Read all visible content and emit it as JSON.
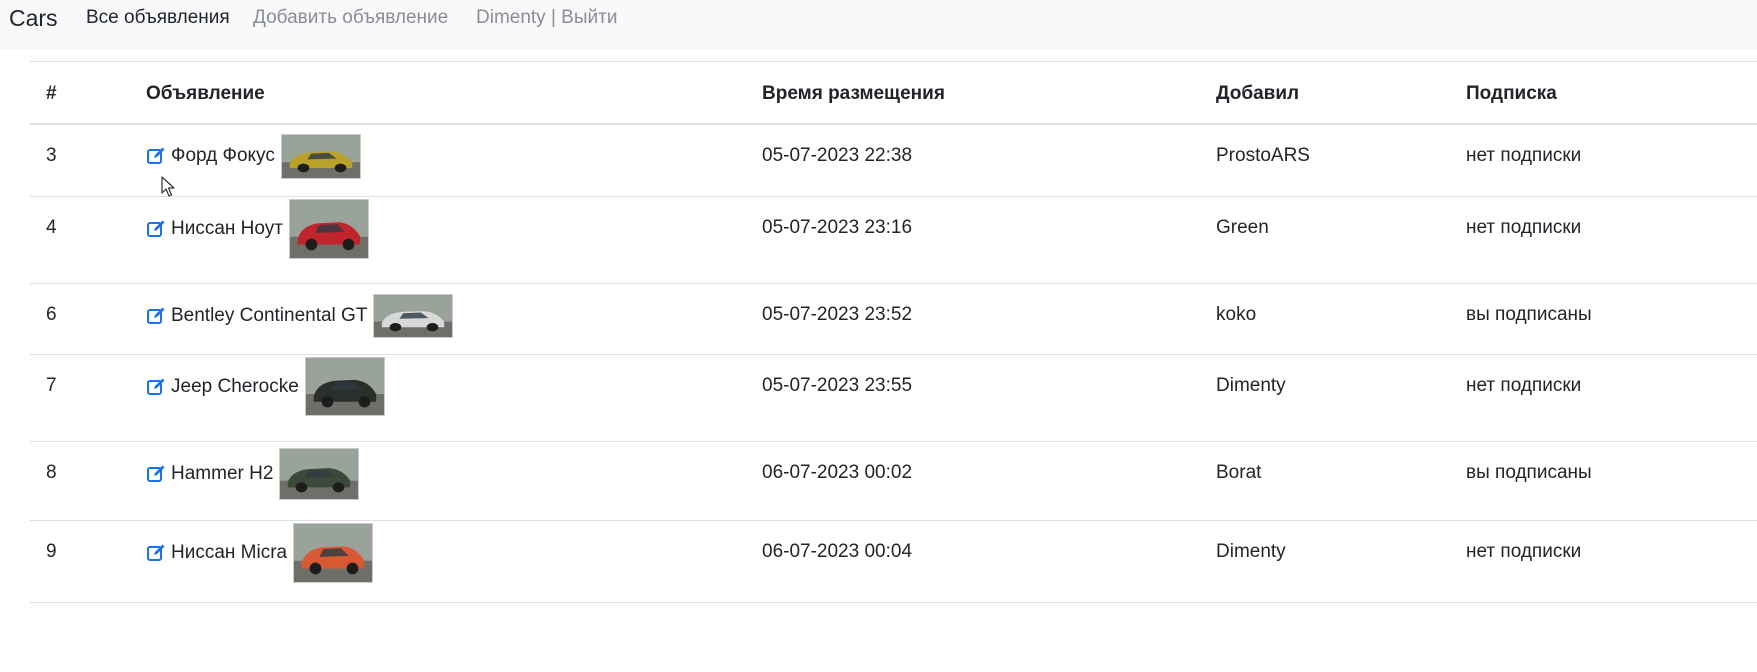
{
  "navbar": {
    "brand": "Cars",
    "links": [
      {
        "label": "Все объявления",
        "active": true
      },
      {
        "label": "Добавить объявление",
        "active": false
      },
      {
        "label": "Dimenty | Выйти",
        "active": false
      }
    ]
  },
  "table": {
    "headers": [
      "#",
      "Объявление",
      "Время размещения",
      "Добавил",
      "Подписка"
    ],
    "rows": [
      {
        "id": "3",
        "title": "Форд Фокус",
        "time": "05-07-2023 22:38",
        "user": "ProstoARS",
        "sub": "нет подписки",
        "thumb_color": "#b8a22a"
      },
      {
        "id": "4",
        "title": "Ниссан Ноут",
        "time": "05-07-2023 23:16",
        "user": "Green",
        "sub": "нет подписки",
        "thumb_color": "#c0242c"
      },
      {
        "id": "6",
        "title": "Bentley Continental GT",
        "time": "05-07-2023 23:52",
        "user": "koko",
        "sub": "вы подписаны",
        "thumb_color": "#d8d8d8"
      },
      {
        "id": "7",
        "title": "Jeep Cherocke",
        "time": "05-07-2023 23:55",
        "user": "Dimenty",
        "sub": "нет подписки",
        "thumb_color": "#2b2f2c"
      },
      {
        "id": "8",
        "title": "Hammer H2",
        "time": "06-07-2023 00:02",
        "user": "Borat",
        "sub": "вы подписаны",
        "thumb_color": "#3c4a3a"
      },
      {
        "id": "9",
        "title": "Ниссан Micra",
        "time": "06-07-2023 00:04",
        "user": "Dimenty",
        "sub": "нет подписки",
        "thumb_color": "#d85a34"
      }
    ]
  },
  "colors": {
    "edit_icon": "#1a73e8",
    "navbar_bg": "#f8f9fa",
    "muted_link": "#8a8d91"
  }
}
